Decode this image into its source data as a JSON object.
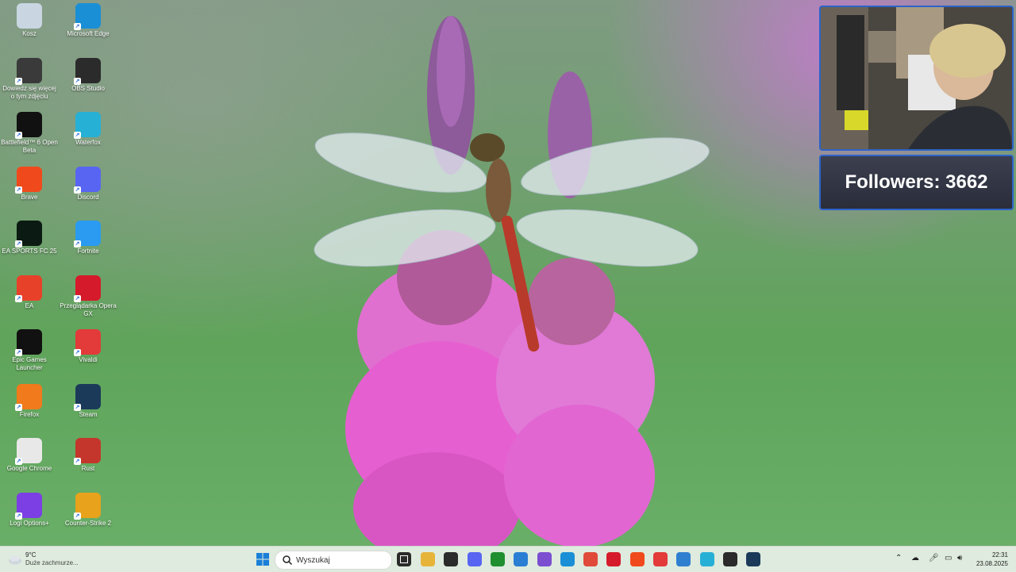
{
  "desktop": {
    "icons": [
      {
        "label": "Kosz",
        "icon": "recycle-bin-icon",
        "color": "#c9d6e2"
      },
      {
        "label": "Microsoft Edge",
        "icon": "edge-icon",
        "color": "#1a8fd6"
      },
      {
        "label": "Dowiedz się więcej o tym zdjęciu",
        "icon": "spotlight-icon",
        "color": "#3a3a3a"
      },
      {
        "label": "OBS Studio",
        "icon": "obs-icon",
        "color": "#2b2b2b"
      },
      {
        "label": "Battlefield™ 6 Open Beta",
        "icon": "battlefield-icon",
        "color": "#111111"
      },
      {
        "label": "Waterfox",
        "icon": "waterfox-icon",
        "color": "#27b0d6"
      },
      {
        "label": "Brave",
        "icon": "brave-icon",
        "color": "#f04a1c"
      },
      {
        "label": "Discord",
        "icon": "discord-icon",
        "color": "#5865f2"
      },
      {
        "label": "EA SPORTS FC 25",
        "icon": "fc25-icon",
        "color": "#0b1a12"
      },
      {
        "label": "Fortnite",
        "icon": "fortnite-icon",
        "color": "#2a9bf0"
      },
      {
        "label": "EA",
        "icon": "ea-icon",
        "color": "#e8412a"
      },
      {
        "label": "Przeglądarka Opera GX",
        "icon": "opera-gx-icon",
        "color": "#d51b2b"
      },
      {
        "label": "Epic Games Launcher",
        "icon": "epic-games-icon",
        "color": "#111111"
      },
      {
        "label": "Vivaldi",
        "icon": "vivaldi-icon",
        "color": "#e33a3a"
      },
      {
        "label": "Firefox",
        "icon": "firefox-icon",
        "color": "#f07a1c"
      },
      {
        "label": "Steam",
        "icon": "steam-icon",
        "color": "#1b3a5a"
      },
      {
        "label": "Google Chrome",
        "icon": "chrome-icon",
        "color": "#e8e8e8"
      },
      {
        "label": "Rust",
        "icon": "rust-icon",
        "color": "#c4362b"
      },
      {
        "label": "Logi Options+",
        "icon": "logi-options-icon",
        "color": "#7b3fe4"
      },
      {
        "label": "Counter-Strike 2",
        "icon": "cs2-icon",
        "color": "#e8a21c"
      }
    ]
  },
  "overlay": {
    "followers_text": "Followers: 3662"
  },
  "taskbar": {
    "weather_temp": "9°C",
    "weather_desc": "Duże zachmurze...",
    "search_placeholder": "Wyszukaj",
    "time": "22:31",
    "date": "23.08.2025",
    "apps": [
      {
        "icon": "file-explorer-icon",
        "color": "#e7b43a"
      },
      {
        "icon": "obs-icon",
        "color": "#2b2b2b"
      },
      {
        "icon": "discord-icon",
        "color": "#5865f2"
      },
      {
        "icon": "xbox-icon",
        "color": "#1f8f2f"
      },
      {
        "icon": "vscode-icon",
        "color": "#2a7fd4"
      },
      {
        "icon": "media-icon",
        "color": "#7b4fd0"
      },
      {
        "icon": "edge-icon",
        "color": "#1a8fd6"
      },
      {
        "icon": "chrome-icon",
        "color": "#e04a3a"
      },
      {
        "icon": "opera-gx-icon",
        "color": "#d51b2b"
      },
      {
        "icon": "brave-icon",
        "color": "#f04a1c"
      },
      {
        "icon": "vivaldi-icon",
        "color": "#e33a3a"
      },
      {
        "icon": "photos-icon",
        "color": "#2f7fd0"
      },
      {
        "icon": "waterfox-icon",
        "color": "#27b0d6"
      },
      {
        "icon": "obs-live-icon",
        "color": "#2b2b2b"
      },
      {
        "icon": "steam-icon",
        "color": "#1b3a5a"
      }
    ]
  }
}
